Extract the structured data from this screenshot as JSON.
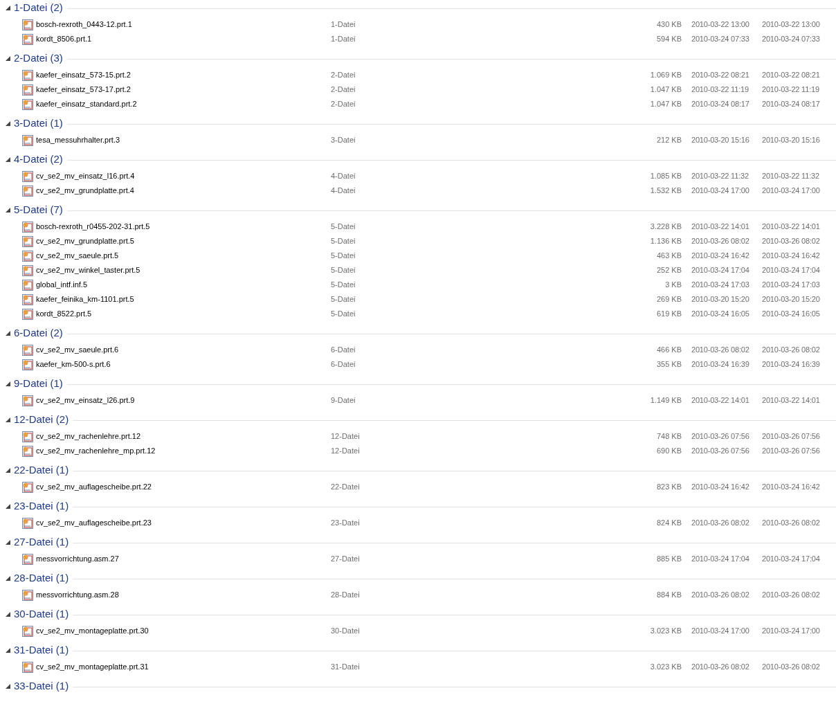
{
  "groups": [
    {
      "title": "1-Datei (2)",
      "expanded": true,
      "files": [
        {
          "name": "bosch-rexroth_0443-12.prt.1",
          "type": "1-Datei",
          "size": "430 KB",
          "date_1": "2010-03-22 13:00",
          "date_2": "2010-03-22 13:00"
        },
        {
          "name": "kordt_8506.prt.1",
          "type": "1-Datei",
          "size": "594 KB",
          "date_1": "2010-03-24 07:33",
          "date_2": "2010-03-24 07:33"
        }
      ]
    },
    {
      "title": "2-Datei (3)",
      "expanded": true,
      "files": [
        {
          "name": "kaefer_einsatz_573-15.prt.2",
          "type": "2-Datei",
          "size": "1.069 KB",
          "date_1": "2010-03-22 08:21",
          "date_2": "2010-03-22 08:21"
        },
        {
          "name": "kaefer_einsatz_573-17.prt.2",
          "type": "2-Datei",
          "size": "1.047 KB",
          "date_1": "2010-03-22 11:19",
          "date_2": "2010-03-22 11:19"
        },
        {
          "name": "kaefer_einsatz_standard.prt.2",
          "type": "2-Datei",
          "size": "1.047 KB",
          "date_1": "2010-03-24 08:17",
          "date_2": "2010-03-24 08:17"
        }
      ]
    },
    {
      "title": "3-Datei (1)",
      "expanded": true,
      "files": [
        {
          "name": "tesa_messuhrhalter.prt.3",
          "type": "3-Datei",
          "size": "212 KB",
          "date_1": "2010-03-20 15:16",
          "date_2": "2010-03-20 15:16"
        }
      ]
    },
    {
      "title": "4-Datei (2)",
      "expanded": true,
      "files": [
        {
          "name": "cv_se2_mv_einsatz_l16.prt.4",
          "type": "4-Datei",
          "size": "1.085 KB",
          "date_1": "2010-03-22 11:32",
          "date_2": "2010-03-22 11:32"
        },
        {
          "name": "cv_se2_mv_grundplatte.prt.4",
          "type": "4-Datei",
          "size": "1.532 KB",
          "date_1": "2010-03-24 17:00",
          "date_2": "2010-03-24 17:00"
        }
      ]
    },
    {
      "title": "5-Datei (7)",
      "expanded": true,
      "files": [
        {
          "name": "bosch-rexroth_r0455-202-31.prt.5",
          "type": "5-Datei",
          "size": "3.228 KB",
          "date_1": "2010-03-22 14:01",
          "date_2": "2010-03-22 14:01"
        },
        {
          "name": "cv_se2_mv_grundplatte.prt.5",
          "type": "5-Datei",
          "size": "1.136 KB",
          "date_1": "2010-03-26 08:02",
          "date_2": "2010-03-26 08:02"
        },
        {
          "name": "cv_se2_mv_saeule.prt.5",
          "type": "5-Datei",
          "size": "463 KB",
          "date_1": "2010-03-24 16:42",
          "date_2": "2010-03-24 16:42"
        },
        {
          "name": "cv_se2_mv_winkel_taster.prt.5",
          "type": "5-Datei",
          "size": "252 KB",
          "date_1": "2010-03-24 17:04",
          "date_2": "2010-03-24 17:04"
        },
        {
          "name": "global_intf.inf.5",
          "type": "5-Datei",
          "size": "3 KB",
          "date_1": "2010-03-24 17:03",
          "date_2": "2010-03-24 17:03"
        },
        {
          "name": "kaefer_feinika_km-1101.prt.5",
          "type": "5-Datei",
          "size": "269 KB",
          "date_1": "2010-03-20 15:20",
          "date_2": "2010-03-20 15:20"
        },
        {
          "name": "kordt_8522.prt.5",
          "type": "5-Datei",
          "size": "619 KB",
          "date_1": "2010-03-24 16:05",
          "date_2": "2010-03-24 16:05"
        }
      ]
    },
    {
      "title": "6-Datei (2)",
      "expanded": true,
      "files": [
        {
          "name": "cv_se2_mv_saeule.prt.6",
          "type": "6-Datei",
          "size": "466 KB",
          "date_1": "2010-03-26 08:02",
          "date_2": "2010-03-26 08:02"
        },
        {
          "name": "kaefer_km-500-s.prt.6",
          "type": "6-Datei",
          "size": "355 KB",
          "date_1": "2010-03-24 16:39",
          "date_2": "2010-03-24 16:39"
        }
      ]
    },
    {
      "title": "9-Datei (1)",
      "expanded": true,
      "files": [
        {
          "name": "cv_se2_mv_einsatz_l26.prt.9",
          "type": "9-Datei",
          "size": "1.149 KB",
          "date_1": "2010-03-22 14:01",
          "date_2": "2010-03-22 14:01"
        }
      ]
    },
    {
      "title": "12-Datei (2)",
      "expanded": true,
      "files": [
        {
          "name": "cv_se2_mv_rachenlehre.prt.12",
          "type": "12-Datei",
          "size": "748 KB",
          "date_1": "2010-03-26 07:56",
          "date_2": "2010-03-26 07:56"
        },
        {
          "name": "cv_se2_mv_rachenlehre_mp.prt.12",
          "type": "12-Datei",
          "size": "690 KB",
          "date_1": "2010-03-26 07:56",
          "date_2": "2010-03-26 07:56"
        }
      ]
    },
    {
      "title": "22-Datei (1)",
      "expanded": true,
      "files": [
        {
          "name": "cv_se2_mv_auflagescheibe.prt.22",
          "type": "22-Datei",
          "size": "823 KB",
          "date_1": "2010-03-24 16:42",
          "date_2": "2010-03-24 16:42"
        }
      ]
    },
    {
      "title": "23-Datei (1)",
      "expanded": true,
      "files": [
        {
          "name": "cv_se2_mv_auflagescheibe.prt.23",
          "type": "23-Datei",
          "size": "824 KB",
          "date_1": "2010-03-26 08:02",
          "date_2": "2010-03-26 08:02"
        }
      ]
    },
    {
      "title": "27-Datei (1)",
      "expanded": true,
      "files": [
        {
          "name": "messvorrichtung.asm.27",
          "type": "27-Datei",
          "size": "885 KB",
          "date_1": "2010-03-24 17:04",
          "date_2": "2010-03-24 17:04"
        }
      ]
    },
    {
      "title": "28-Datei (1)",
      "expanded": true,
      "files": [
        {
          "name": "messvorrichtung.asm.28",
          "type": "28-Datei",
          "size": "884 KB",
          "date_1": "2010-03-26 08:02",
          "date_2": "2010-03-26 08:02"
        }
      ]
    },
    {
      "title": "30-Datei (1)",
      "expanded": true,
      "files": [
        {
          "name": "cv_se2_mv_montageplatte.prt.30",
          "type": "30-Datei",
          "size": "3.023 KB",
          "date_1": "2010-03-24 17:00",
          "date_2": "2010-03-24 17:00"
        }
      ]
    },
    {
      "title": "31-Datei (1)",
      "expanded": true,
      "files": [
        {
          "name": "cv_se2_mv_montageplatte.prt.31",
          "type": "31-Datei",
          "size": "3.023 KB",
          "date_1": "2010-03-26 08:02",
          "date_2": "2010-03-26 08:02"
        }
      ]
    },
    {
      "title": "33-Datei (1)",
      "expanded": true
    }
  ]
}
